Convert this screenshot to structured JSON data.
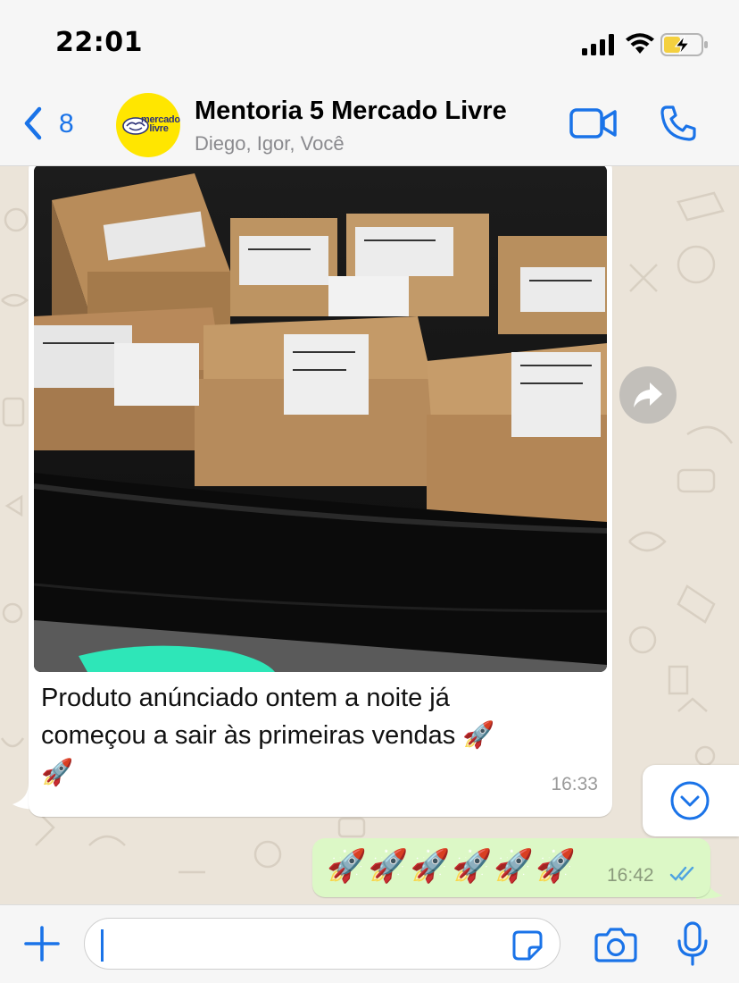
{
  "status_bar": {
    "time": "22:01",
    "icons": [
      "cellular-signal-icon",
      "wifi-icon",
      "battery-charging-icon"
    ]
  },
  "header": {
    "back_count": "8",
    "avatar_brand": "mercado livre",
    "chat_title": "Mentoria 5 Mercado Livre",
    "members": "Diego, Igor, Você",
    "icons": [
      "back-chevron-icon",
      "video-call-icon",
      "phone-icon"
    ]
  },
  "messages": [
    {
      "direction": "incoming",
      "type": "image",
      "caption_line1": "Produto anúnciado ontem a noite já",
      "caption_line2": "começou a sair às primeiras vendas 🚀",
      "caption_line3": "🚀",
      "time": "16:33"
    },
    {
      "direction": "outgoing",
      "text": "🚀🚀🚀🚀🚀🚀",
      "time": "16:42",
      "status": "read"
    }
  ],
  "input_bar": {
    "placeholder": "",
    "icons": [
      "plus-icon",
      "sticker-icon",
      "camera-icon",
      "microphone-icon"
    ]
  },
  "colors": {
    "accent": "#1a73e8",
    "outgoing_bubble": "#dcf8c6",
    "incoming_bubble": "#ffffff",
    "chat_background": "#ebe4d9"
  }
}
